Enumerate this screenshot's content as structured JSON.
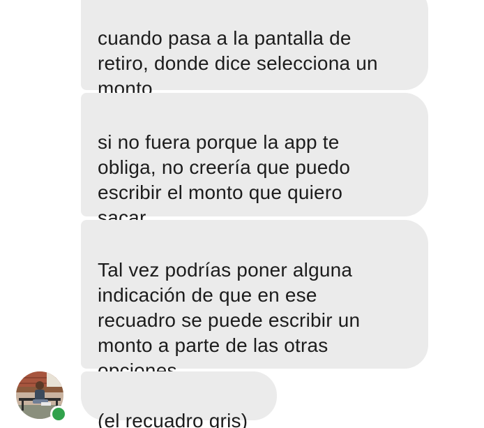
{
  "messages": [
    {
      "text": "cuando pasa a la pantalla de\nretiro, donde dice selecciona un\nmonto"
    },
    {
      "text": "si no fuera porque la app te\nobliga, no creería que puedo\nescribir el monto que quiero\nsacar"
    },
    {
      "text": "Tal vez podrías poner alguna\nindicación de que en ese\nrecuadro se puede escribir un\nmonto a parte de las otras\nopciones"
    },
    {
      "text": "(el recuadro gris)"
    }
  ],
  "sender": {
    "online": true,
    "presence_color": "#31a24c"
  },
  "colors": {
    "bubble_background": "#ebebeb",
    "text": "#1c1c1c"
  }
}
